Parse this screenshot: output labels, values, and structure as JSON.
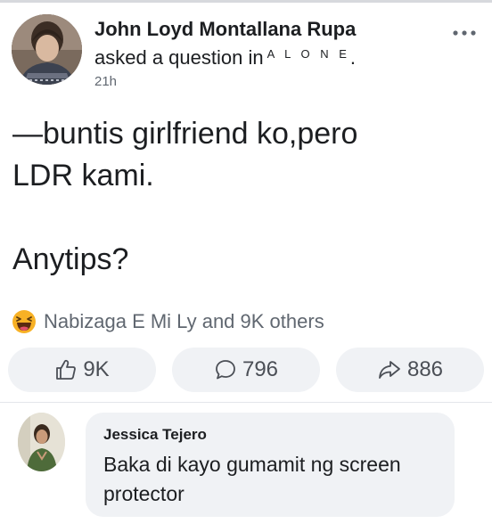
{
  "post": {
    "author": "John Loyd Montallana Rupa",
    "asked_prefix": "asked a question in",
    "group": "A L O N E",
    "group_suffix": ".",
    "time": "21h",
    "text_line1": "—buntis girlfriend ko,pero",
    "text_line2": "LDR kami.",
    "text_line3": "Anytips?"
  },
  "reactions": {
    "icon": "haha-emoji-icon",
    "summary": "Nabizaga E Mi Ly and 9K others"
  },
  "actions": {
    "like_count": "9K",
    "comment_count": "796",
    "share_count": "886"
  },
  "comment": {
    "author": "Jessica Tejero",
    "text": "Baka di kayo gumamit ng screen protector"
  },
  "colors": {
    "text": "#1c1e21",
    "secondary_text": "#606770",
    "button_bg": "#f0f2f5",
    "bubble_bg": "#f0f2f5",
    "haha_yellow": "#f7b125"
  }
}
